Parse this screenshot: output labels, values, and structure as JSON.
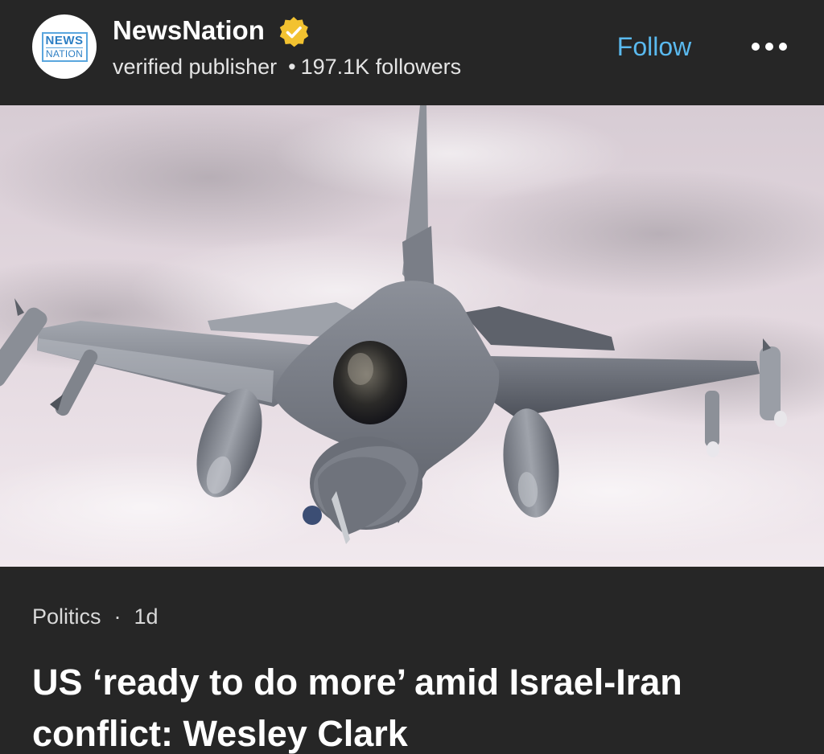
{
  "publisher": {
    "logo_top": "NEWS",
    "logo_bottom": "NATION",
    "name": "NewsNation",
    "verified_icon": "verified-badge-icon",
    "label": "verified publisher",
    "followers": "197.1K followers",
    "follow_label": "Follow",
    "more_icon": "more-options-icon"
  },
  "hero": {
    "image": "fighter-jet-photo"
  },
  "article": {
    "category": "Politics",
    "age": "1d",
    "headline": "US ‘ready to do more’ amid Israel-Iran conflict: Wesley Clark"
  },
  "colors": {
    "background": "#262626",
    "accent": "#5ab9ee",
    "badge": "#f2c230"
  }
}
